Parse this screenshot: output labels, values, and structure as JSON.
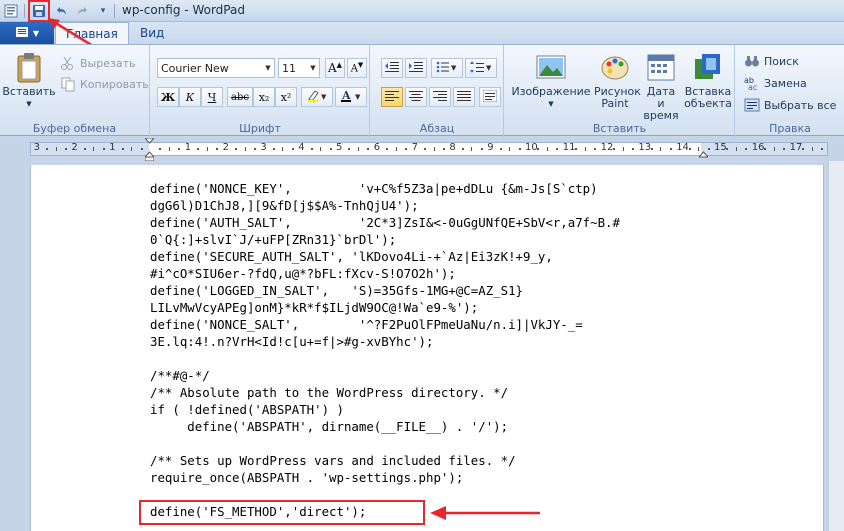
{
  "window": {
    "title": "wp-config - WordPad"
  },
  "tabs": [
    {
      "label": "Главная"
    },
    {
      "label": "Вид"
    }
  ],
  "ribbon": {
    "clipboard": {
      "group_label": "Буфер обмена",
      "paste_label": "Вставить",
      "cut_label": "Вырезать",
      "copy_label": "Копировать"
    },
    "font": {
      "group_label": "Шрифт",
      "family": "Courier New",
      "size": "11",
      "bold": "Ж",
      "italic": "К",
      "underline": "Ч",
      "strike": "abc",
      "subscript": "x₂",
      "superscript": "x²"
    },
    "paragraph": {
      "group_label": "Абзац"
    },
    "insert": {
      "group_label": "Вставить",
      "image_label": "Изображение",
      "paint_label": "Рисунок Paint",
      "datetime_label": "Дата и время",
      "object_label": "Вставка объекта"
    },
    "editing": {
      "group_label": "Правка",
      "find_label": "Поиск",
      "replace_label": "Замена",
      "select_all_label": "Выбрать все"
    }
  },
  "ruler": {
    "labels": [
      "3",
      "2",
      "1",
      "1",
      "2",
      "3",
      "4",
      "5",
      "6",
      "7",
      "8",
      "9",
      "10",
      "11",
      "12",
      "13",
      "14",
      "15",
      "16",
      "17"
    ]
  },
  "document": {
    "lines": [
      "define('NONCE_KEY',         'v+C%f5Z3a|pe+dDLu {&m-Js[S`ctp)",
      "dgG6l)D1ChJ8,][9&fD[j$$A%-TnhQjU4');",
      "define('AUTH_SALT',         '2C*3]ZsI&<-0uGgUNfQE+SbV<r,a7f~B.#",
      "0`Q{:]+slvI`J/+uFP[ZRn31}`brDl');",
      "define('SECURE_AUTH_SALT', 'lKDovo4Li-+`Az|Ei3zK!+9_y,",
      "#i^cO*SIU6er-?fdQ,u@*?bFL:fXcv-S!O7O2h');",
      "define('LOGGED_IN_SALT',   'S)=35Gfs-1MG+@C=AZ_S1}",
      "LILvMwVcyAPEg]onM}*kR*f$ILjdW9OC@!Wa`e9-%');",
      "define('NONCE_SALT',        '^?F2PuOlFPmeUaNu/n.i]|VkJY-_=",
      "3E.lq:4!.n?VrH<Id!c[u+=f|>#g-xvBYhc');",
      "",
      "/**#@-*/",
      "/** Absolute path to the WordPress directory. */",
      "if ( !defined('ABSPATH') )",
      "     define('ABSPATH', dirname(__FILE__) . '/');",
      "",
      "/** Sets up WordPress vars and included files. */",
      "require_once(ABSPATH . 'wp-settings.php');",
      "",
      "define('FS_METHOD','direct');"
    ]
  },
  "colors": {
    "annotation": "#e8262b",
    "app_menu": "#1b4f9e"
  }
}
